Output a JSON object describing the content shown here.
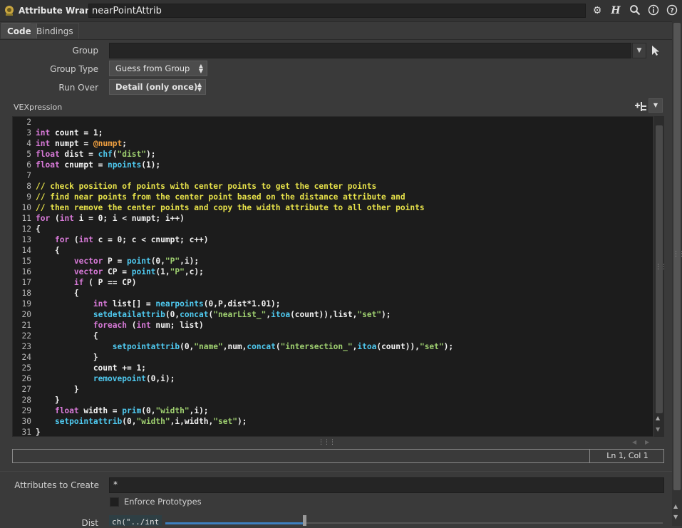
{
  "header": {
    "node_type": "Attribute Wrangle",
    "node_name": "nearPointAttrib",
    "icons": [
      "gear-icon",
      "houdini-h-icon",
      "search-icon",
      "info-icon",
      "help-icon"
    ]
  },
  "tabs": [
    "Code",
    "Bindings"
  ],
  "params": {
    "group_label": "Group",
    "group_value": "",
    "group_type_label": "Group Type",
    "group_type_value": "Guess from Group",
    "run_over_label": "Run Over",
    "run_over_value": "Detail (only once)",
    "vexpression_label": "VEXpression",
    "attributes_to_create_label": "Attributes to Create",
    "attributes_to_create_value": "*",
    "enforce_prototypes_label": "Enforce Prototypes",
    "dist_label": "Dist",
    "dist_value": "ch(\"../int"
  },
  "editor": {
    "cursor_position": "Ln 1, Col 1",
    "lines": [
      {
        "n": "2",
        "segs": []
      },
      {
        "n": "3",
        "segs": [
          [
            "k",
            "int"
          ],
          [
            "t",
            " count = 1;"
          ]
        ]
      },
      {
        "n": "4",
        "segs": [
          [
            "k",
            "int"
          ],
          [
            "t",
            " numpt = "
          ],
          [
            "a",
            "@numpt"
          ],
          [
            "t",
            ";"
          ]
        ]
      },
      {
        "n": "5",
        "segs": [
          [
            "k",
            "float"
          ],
          [
            "t",
            " dist = "
          ],
          [
            "f",
            "chf"
          ],
          [
            "t",
            "("
          ],
          [
            "s",
            "\"dist\""
          ],
          [
            "t",
            ");"
          ]
        ]
      },
      {
        "n": "6",
        "segs": [
          [
            "k",
            "float"
          ],
          [
            "t",
            " cnumpt = "
          ],
          [
            "f",
            "npoints"
          ],
          [
            "t",
            "(1);"
          ]
        ]
      },
      {
        "n": "7",
        "segs": []
      },
      {
        "n": "8",
        "segs": [
          [
            "c",
            "// check position of points with center points to get the center points"
          ]
        ]
      },
      {
        "n": "9",
        "segs": [
          [
            "c",
            "// find near points from the center point based on the distance attribute and"
          ]
        ]
      },
      {
        "n": "10",
        "segs": [
          [
            "c",
            "// then remove the center points and copy the width attribute to all other points"
          ]
        ]
      },
      {
        "n": "11",
        "segs": [
          [
            "k",
            "for"
          ],
          [
            "t",
            " ("
          ],
          [
            "k",
            "int"
          ],
          [
            "t",
            " i = 0; i < numpt; i++)"
          ]
        ]
      },
      {
        "n": "12",
        "segs": [
          [
            "t",
            "{"
          ]
        ]
      },
      {
        "n": "13",
        "segs": [
          [
            "t",
            "    "
          ],
          [
            "k",
            "for"
          ],
          [
            "t",
            " ("
          ],
          [
            "k",
            "int"
          ],
          [
            "t",
            " c = 0; c < cnumpt; c++)"
          ]
        ]
      },
      {
        "n": "14",
        "segs": [
          [
            "t",
            "    {"
          ]
        ]
      },
      {
        "n": "15",
        "segs": [
          [
            "t",
            "        "
          ],
          [
            "k",
            "vector"
          ],
          [
            "t",
            " P = "
          ],
          [
            "f",
            "point"
          ],
          [
            "t",
            "(0,"
          ],
          [
            "s",
            "\"P\""
          ],
          [
            "t",
            ",i);"
          ]
        ]
      },
      {
        "n": "16",
        "segs": [
          [
            "t",
            "        "
          ],
          [
            "k",
            "vector"
          ],
          [
            "t",
            " CP = "
          ],
          [
            "f",
            "point"
          ],
          [
            "t",
            "(1,"
          ],
          [
            "s",
            "\"P\""
          ],
          [
            "t",
            ",c);"
          ]
        ]
      },
      {
        "n": "17",
        "segs": [
          [
            "t",
            "        "
          ],
          [
            "k",
            "if"
          ],
          [
            "t",
            " ( P == CP)"
          ]
        ]
      },
      {
        "n": "18",
        "segs": [
          [
            "t",
            "        {"
          ]
        ]
      },
      {
        "n": "19",
        "segs": [
          [
            "t",
            "            "
          ],
          [
            "k",
            "int"
          ],
          [
            "t",
            " list[] = "
          ],
          [
            "f",
            "nearpoints"
          ],
          [
            "t",
            "(0,P,dist*1.01);"
          ]
        ]
      },
      {
        "n": "20",
        "segs": [
          [
            "t",
            "            "
          ],
          [
            "f",
            "setdetailattrib"
          ],
          [
            "t",
            "(0,"
          ],
          [
            "f",
            "concat"
          ],
          [
            "t",
            "("
          ],
          [
            "s",
            "\"nearList_\""
          ],
          [
            "t",
            ","
          ],
          [
            "f",
            "itoa"
          ],
          [
            "t",
            "(count)),list,"
          ],
          [
            "s",
            "\"set\""
          ],
          [
            "t",
            ");"
          ]
        ]
      },
      {
        "n": "21",
        "segs": [
          [
            "t",
            "            "
          ],
          [
            "k",
            "foreach"
          ],
          [
            "t",
            " ("
          ],
          [
            "k",
            "int"
          ],
          [
            "t",
            " num; list)"
          ]
        ]
      },
      {
        "n": "22",
        "segs": [
          [
            "t",
            "            {"
          ]
        ]
      },
      {
        "n": "23",
        "segs": [
          [
            "t",
            "                "
          ],
          [
            "f",
            "setpointattrib"
          ],
          [
            "t",
            "(0,"
          ],
          [
            "s",
            "\"name\""
          ],
          [
            "t",
            ",num,"
          ],
          [
            "f",
            "concat"
          ],
          [
            "t",
            "("
          ],
          [
            "s",
            "\"intersection_\""
          ],
          [
            "t",
            ","
          ],
          [
            "f",
            "itoa"
          ],
          [
            "t",
            "(count)),"
          ],
          [
            "s",
            "\"set\""
          ],
          [
            "t",
            ");"
          ]
        ]
      },
      {
        "n": "24",
        "segs": [
          [
            "t",
            "            }"
          ]
        ]
      },
      {
        "n": "25",
        "segs": [
          [
            "t",
            "            count += 1;"
          ]
        ]
      },
      {
        "n": "26",
        "segs": [
          [
            "t",
            "            "
          ],
          [
            "f",
            "removepoint"
          ],
          [
            "t",
            "(0,i);"
          ]
        ]
      },
      {
        "n": "27",
        "segs": [
          [
            "t",
            "        }"
          ]
        ]
      },
      {
        "n": "28",
        "segs": [
          [
            "t",
            "    }"
          ]
        ]
      },
      {
        "n": "29",
        "segs": [
          [
            "t",
            "    "
          ],
          [
            "k",
            "float"
          ],
          [
            "t",
            " width = "
          ],
          [
            "f",
            "prim"
          ],
          [
            "t",
            "(0,"
          ],
          [
            "s",
            "\"width\""
          ],
          [
            "t",
            ",i);"
          ]
        ]
      },
      {
        "n": "30",
        "segs": [
          [
            "t",
            "    "
          ],
          [
            "f",
            "setpointattrib"
          ],
          [
            "t",
            "(0,"
          ],
          [
            "s",
            "\"width\""
          ],
          [
            "t",
            ",i,width,"
          ],
          [
            "s",
            "\"set\""
          ],
          [
            "t",
            ");"
          ]
        ]
      },
      {
        "n": "31",
        "segs": [
          [
            "t",
            "}"
          ]
        ]
      }
    ]
  }
}
